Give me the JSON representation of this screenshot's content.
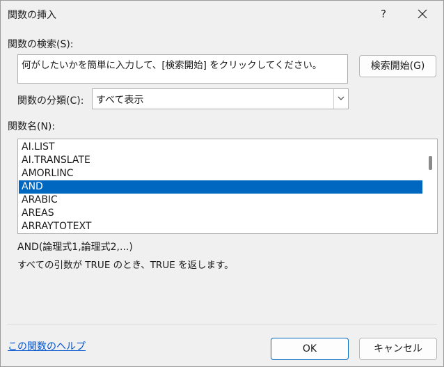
{
  "window": {
    "title": "関数の挿入",
    "help_label": "?"
  },
  "search": {
    "label": "関数の検索(S):",
    "text": "何がしたいかを簡単に入力して、[検索開始] をクリックしてください。",
    "button_label": "検索開始(G)"
  },
  "category": {
    "label": "関数の分類(C):",
    "value": "すべて表示"
  },
  "function_list": {
    "label": "関数名(N):",
    "items": [
      {
        "name": "AI.LIST",
        "selected": false
      },
      {
        "name": "AI.TRANSLATE",
        "selected": false
      },
      {
        "name": "AMORLINC",
        "selected": false
      },
      {
        "name": "AND",
        "selected": true
      },
      {
        "name": "ARABIC",
        "selected": false
      },
      {
        "name": "AREAS",
        "selected": false
      },
      {
        "name": "ARRAYTOTEXT",
        "selected": false
      }
    ]
  },
  "details": {
    "syntax": "AND(論理式1,論理式2,...)",
    "description": "すべての引数が TRUE のとき、TRUE を返します。"
  },
  "footer": {
    "help_link": "この関数のヘルプ",
    "ok_label": "OK",
    "cancel_label": "キャンセル"
  },
  "colors": {
    "selection": "#0067c0",
    "link": "#0055cc",
    "background": "#f0f0f0"
  },
  "icons": {
    "close": "close-icon",
    "dropdown": "chevron-down-icon"
  }
}
